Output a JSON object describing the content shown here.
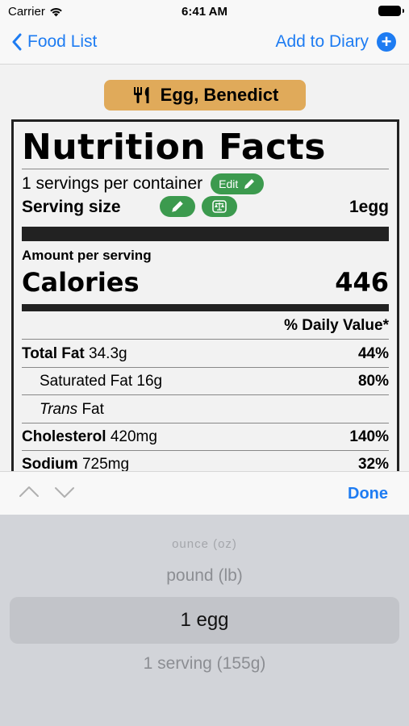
{
  "status_bar": {
    "carrier": "Carrier",
    "time": "6:41 AM"
  },
  "nav": {
    "back_label": "Food List",
    "action_label": "Add to Diary"
  },
  "food": {
    "name": "Egg, Benedict"
  },
  "label": {
    "title": "Nutrition Facts",
    "servings_text": "1 servings per container",
    "edit_label": "Edit",
    "serving_size_label": "Serving size",
    "serving_size_value": "1egg",
    "amount_per_serving": "Amount per serving",
    "calories_label": "Calories",
    "calories_value": "446",
    "dv_header": "% Daily Value*",
    "nutrients": [
      {
        "name": "Total Fat",
        "amount": "34.3g",
        "pct": "44%"
      },
      {
        "name": "Saturated Fat",
        "amount": "16g",
        "pct": "80%"
      },
      {
        "name_italic": "Trans",
        "name": "Fat",
        "amount": "",
        "pct": ""
      },
      {
        "name": "Cholesterol",
        "amount": "420mg",
        "pct": "140%"
      },
      {
        "name": "Sodium",
        "amount": "725mg",
        "pct": "32%"
      }
    ]
  },
  "toolbar": {
    "done_label": "Done"
  },
  "picker": {
    "options": [
      "ounce (oz)",
      "pound (lb)",
      "1 egg",
      "1 serving (155g)"
    ],
    "selected": "1 egg"
  },
  "colors": {
    "accent": "#1e7cf2",
    "pill_green": "#3c9a4e",
    "food_pill": "#e0aa5a"
  }
}
